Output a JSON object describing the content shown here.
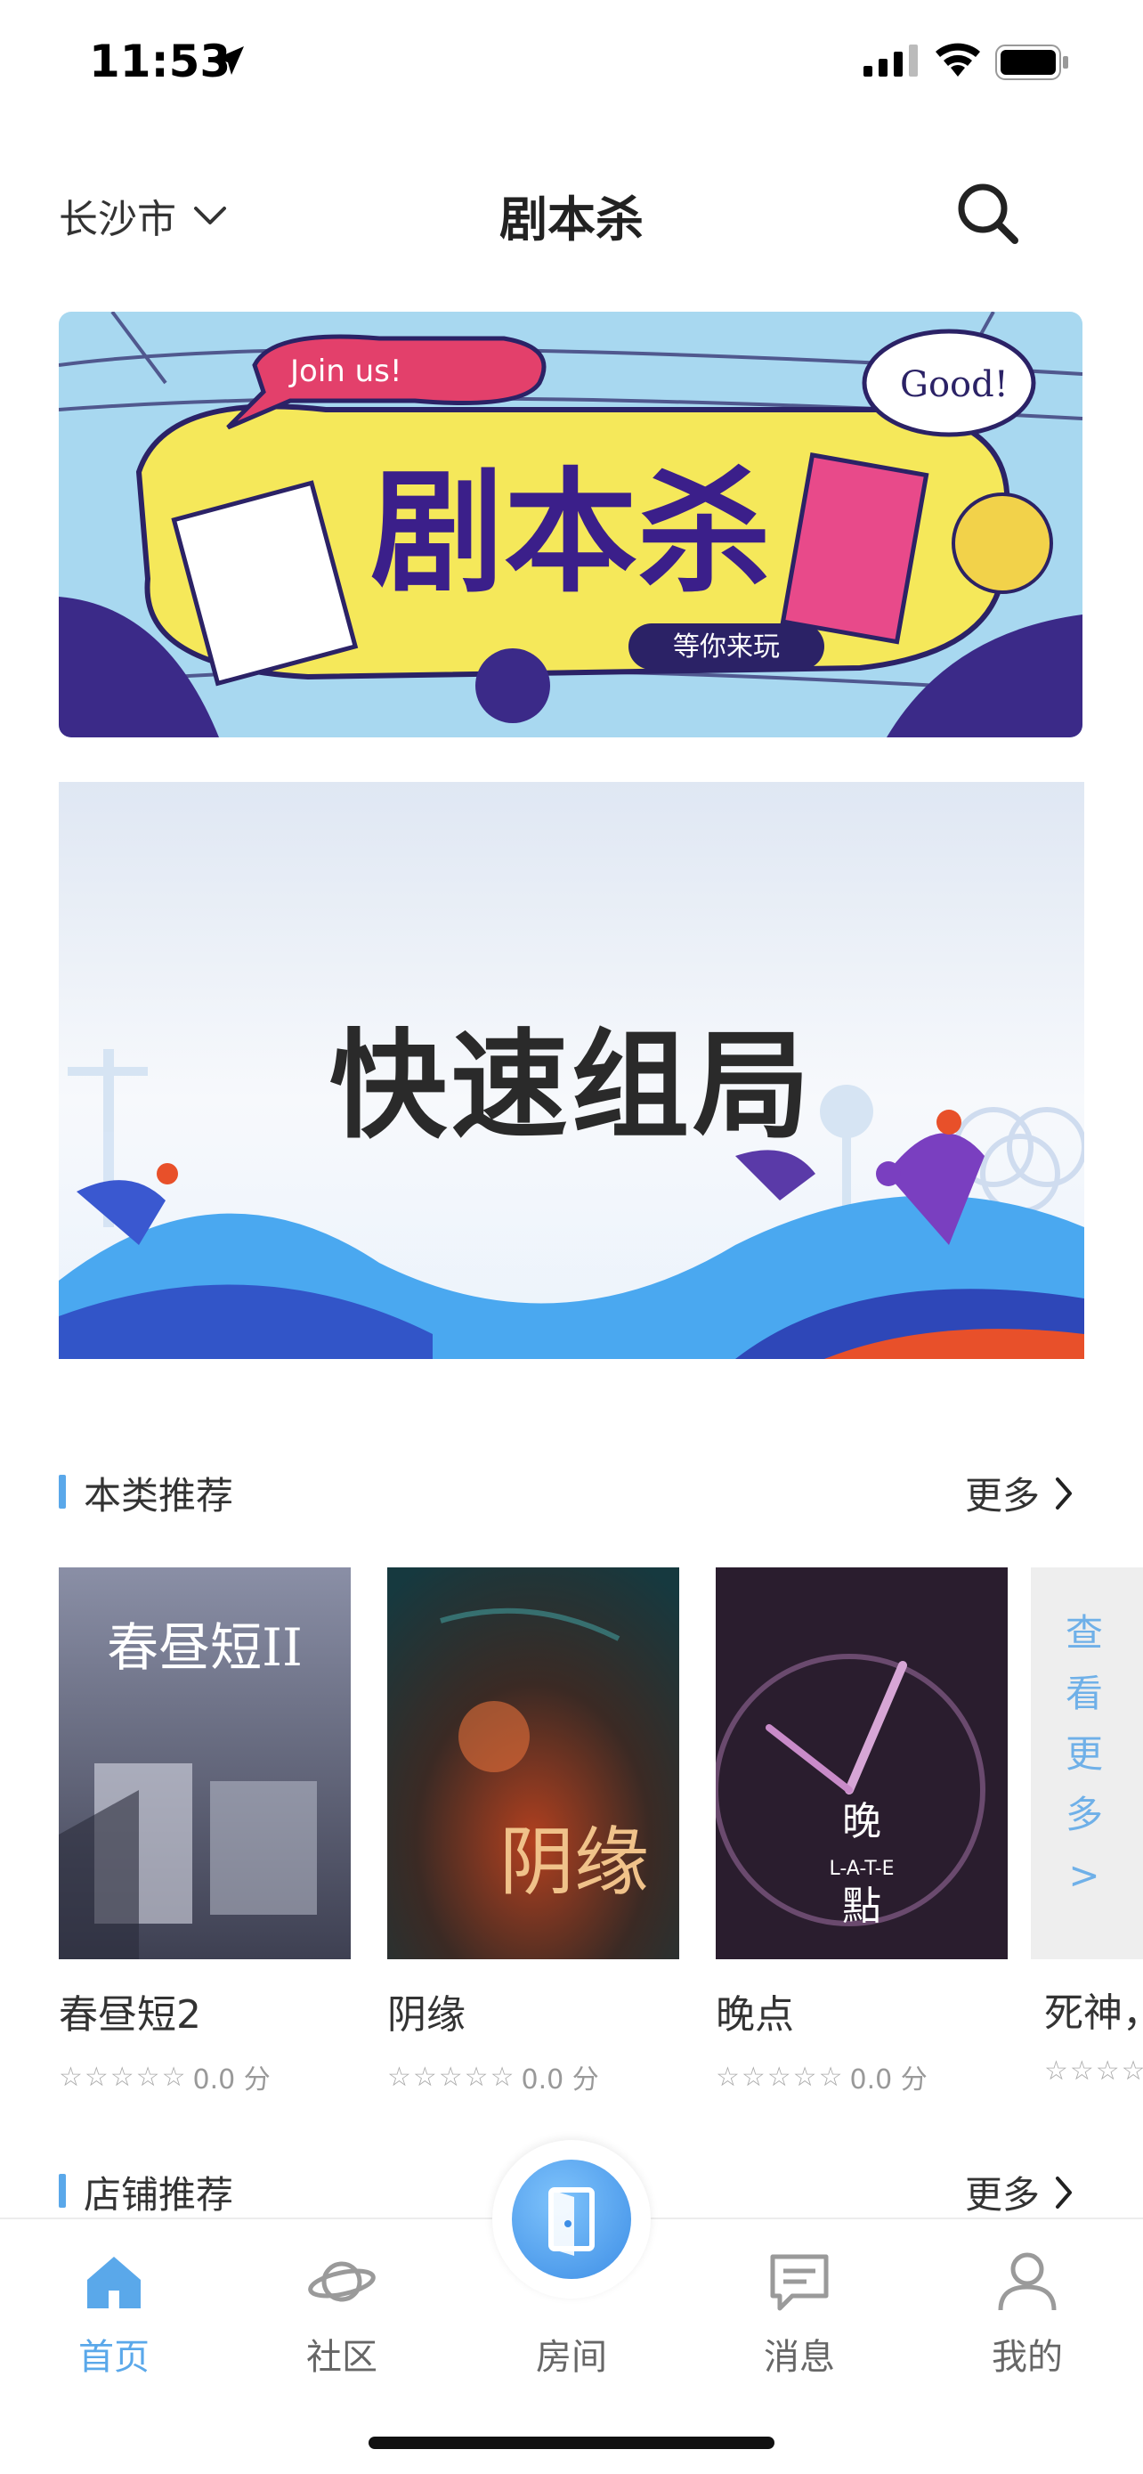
{
  "status_bar": {
    "time": "11:53"
  },
  "header": {
    "city": "长沙市",
    "title": "剧本杀"
  },
  "banners": {
    "top": {
      "tag": "Join us!",
      "bubble": "Good!",
      "headline": "剧本杀",
      "sub": "等你来玩"
    },
    "quick": {
      "headline": "快速组局"
    }
  },
  "recommend": {
    "label": "本类推荐",
    "more": "更多",
    "items": [
      {
        "title": "春昼短2",
        "poster_text": "春昼短II",
        "score": "0.0 分"
      },
      {
        "title": "阴缘",
        "poster_text": "阴缘",
        "score": "0.0 分"
      },
      {
        "title": "晚点",
        "poster_text": "晚\nL-A-T-E\n點",
        "score": "0.0 分"
      },
      {
        "title": "死神，",
        "score": ""
      }
    ],
    "see_more": "查看更多>"
  },
  "shops": {
    "label": "店铺推荐",
    "more": "更多"
  },
  "tabs": [
    {
      "label": "首页",
      "icon": "home-icon",
      "active": true
    },
    {
      "label": "社区",
      "icon": "planet-icon",
      "active": false
    },
    {
      "label": "房间",
      "icon": "door-icon",
      "active": false
    },
    {
      "label": "消息",
      "icon": "message-icon",
      "active": false
    },
    {
      "label": "我的",
      "icon": "user-icon",
      "active": false
    }
  ],
  "colors": {
    "accent": "#5aa8ea",
    "text": "#333333"
  }
}
